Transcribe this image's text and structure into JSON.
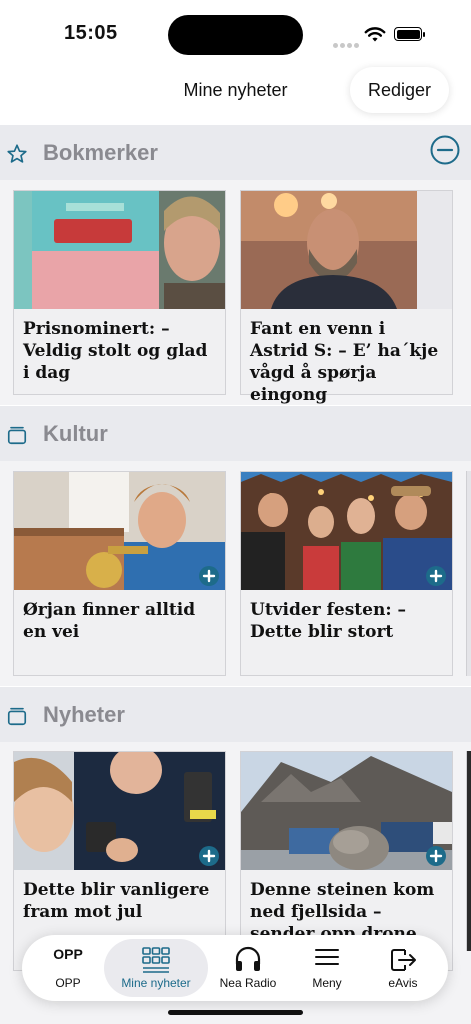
{
  "status_bar": {
    "time": "15:05"
  },
  "header": {
    "title": "Mine nyheter",
    "edit_label": "Rediger"
  },
  "sections": [
    {
      "title": "Bokmerker",
      "icon": "star-icon",
      "cards": [
        {
          "title": "Prisnominert: – Veldig stolt og glad i dag",
          "image": "author-with-book-photo"
        },
        {
          "title": "Fant en venn i Astrid S: – E’ ha´kje vågd å spørja eingong",
          "image": "bearded-man-portrait-photo"
        }
      ]
    },
    {
      "title": "Kultur",
      "icon": "stack-icon",
      "cards": [
        {
          "title": "Ørjan finner alltid en vei",
          "image": "man-with-trumpet-photo"
        },
        {
          "title": "Utvider festen: – Dette blir stort",
          "image": "oktoberfest-group-photo"
        }
      ]
    },
    {
      "title": "Nyheter",
      "icon": "stack-icon",
      "cards": [
        {
          "title": "Dette blir vanligere fram mot jul",
          "image": "police-breathalyzer-photo"
        },
        {
          "title": "Denne steinen kom ned fjellsida – sender opp drone",
          "image": "rockfall-mountain-photo"
        }
      ]
    }
  ],
  "tab_bar": {
    "items": [
      {
        "label": "OPP",
        "icon_text": "OPP",
        "icon": "opp-logo-icon"
      },
      {
        "label": "Mine nyheter",
        "icon": "grid-icon",
        "active": true
      },
      {
        "label": "Nea Radio",
        "icon": "headphones-icon"
      },
      {
        "label": "Meny",
        "icon": "hamburger-menu-icon"
      },
      {
        "label": "eAvis",
        "icon": "exit-arrow-icon"
      }
    ]
  },
  "colors": {
    "accent": "#1d6b8a",
    "section_header_bg": "#e9eaee",
    "section_title": "#8a8a90"
  }
}
